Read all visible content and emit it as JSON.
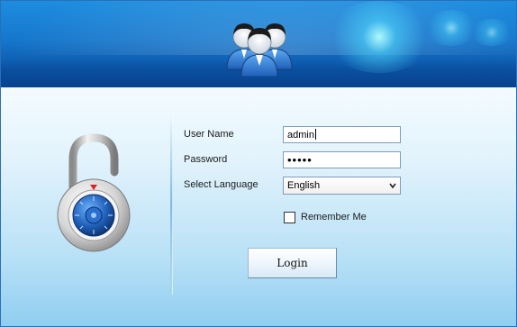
{
  "form": {
    "username_label": "User Name",
    "username_value": "admin",
    "password_label": "Password",
    "password_value": "•••••",
    "language_label": "Select Language",
    "language_selected": "English",
    "remember_label": "Remember Me",
    "remember_checked": false,
    "login_label": "Login"
  },
  "icons": {
    "header": "users-group-icon",
    "side": "padlock-icon",
    "dropdown": "chevron-down-icon"
  },
  "colors": {
    "banner_top": "#1e8ddf",
    "banner_bottom": "#0a4f9e",
    "body_top": "#f4fbff",
    "body_bottom": "#8fcdf0",
    "lock_dial": "#1f5fb8"
  }
}
